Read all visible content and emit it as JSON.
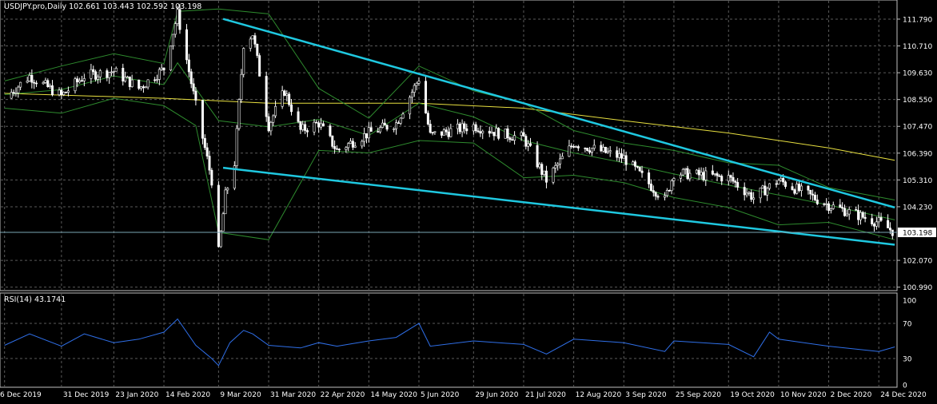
{
  "window": {
    "symbol_header": "USDJPY.pro,Daily  102.661 103.443 102.592 103.198",
    "rsi_header": "RSI(14) 43.1741"
  },
  "colors": {
    "background": "#000000",
    "grid": "#5a5a5a",
    "bull_candle": "#000000",
    "bear_candle": "#ffffff",
    "candle_wick": "#ffffff",
    "bollinger": "#2e8b2e",
    "moving_average": "#e8e040",
    "trendline": "#1fc8e0",
    "rsi_line": "#2f6fe8",
    "price_line": "#7aa6b4",
    "axis_text": "#ffffff"
  },
  "chart_data": [
    {
      "type": "candlestick",
      "title": "USDJPY.pro,Daily",
      "ohlc_last": {
        "open": 102.661,
        "high": 103.443,
        "low": 102.592,
        "close": 103.198
      },
      "current_price_label": "103.198",
      "y_ticks": [
        "111.790",
        "110.710",
        "109.630",
        "108.550",
        "107.470",
        "106.390",
        "105.310",
        "104.230",
        "103.198",
        "102.070",
        "100.990"
      ],
      "ylim": [
        100.85,
        112.4
      ],
      "x_ticks": [
        "6 Dec 2019",
        "31 Dec 2019",
        "23 Jan 2020",
        "14 Feb 2020",
        "9 Mar 2020",
        "31 Mar 2020",
        "22 Apr 2020",
        "14 May 2020",
        "5 Jun 2020",
        "29 Jun 2020",
        "21 Jul 2020",
        "12 Aug 2020",
        "3 Sep 2020",
        "25 Sep 2020",
        "19 Oct 2020",
        "10 Nov 2020",
        "2 Dec 2020",
        "24 Dec 2020"
      ],
      "close_path": [
        [
          "6 Dec 2019",
          108.6
        ],
        [
          "17 Dec 2019",
          109.5
        ],
        [
          "31 Dec 2019",
          108.7
        ],
        [
          "10 Jan 2020",
          109.5
        ],
        [
          "23 Jan 2020",
          109.7
        ],
        [
          "3 Feb 2020",
          109.0
        ],
        [
          "14 Feb 2020",
          109.8
        ],
        [
          "20 Feb 2020",
          112.0
        ],
        [
          "28 Feb 2020",
          108.3
        ],
        [
          "6 Mar 2020",
          105.3
        ],
        [
          "9 Mar 2020",
          102.4
        ],
        [
          "12 Mar 2020",
          104.7
        ],
        [
          "16 Mar 2020",
          106.0
        ],
        [
          "20 Mar 2020",
          110.8
        ],
        [
          "24 Mar 2020",
          111.2
        ],
        [
          "31 Mar 2020",
          107.5
        ],
        [
          "7 Apr 2020",
          108.9
        ],
        [
          "14 Apr 2020",
          107.3
        ],
        [
          "22 Apr 2020",
          107.6
        ],
        [
          "30 Apr 2020",
          106.5
        ],
        [
          "14 May 2020",
          107.2
        ],
        [
          "26 May 2020",
          107.6
        ],
        [
          "5 Jun 2020",
          109.4
        ],
        [
          "10 Jun 2020",
          107.1
        ],
        [
          "29 Jun 2020",
          107.5
        ],
        [
          "10 Jul 2020",
          107.2
        ],
        [
          "21 Jul 2020",
          107.0
        ],
        [
          "31 Jul 2020",
          105.3
        ],
        [
          "12 Aug 2020",
          106.8
        ],
        [
          "3 Sep 2020",
          106.2
        ],
        [
          "21 Sep 2020",
          104.5
        ],
        [
          "25 Sep 2020",
          105.6
        ],
        [
          "19 Oct 2020",
          105.4
        ],
        [
          "30 Oct 2020",
          104.6
        ],
        [
          "10 Nov 2020",
          105.3
        ],
        [
          "2 Dec 2020",
          104.3
        ],
        [
          "24 Dec 2020",
          103.6
        ],
        [
          "31 Dec 2020",
          103.198
        ]
      ],
      "bollinger_upper": [
        [
          "6 Dec 2019",
          109.3
        ],
        [
          "31 Dec 2019",
          109.9
        ],
        [
          "23 Jan 2020",
          110.4
        ],
        [
          "14 Feb 2020",
          110.0
        ],
        [
          "20 Feb 2020",
          112.1
        ],
        [
          "9 Mar 2020",
          112.2
        ],
        [
          "31 Mar 2020",
          112.0
        ],
        [
          "22 Apr 2020",
          109.0
        ],
        [
          "14 May 2020",
          107.8
        ],
        [
          "5 Jun 2020",
          109.9
        ],
        [
          "29 Jun 2020",
          108.9
        ],
        [
          "21 Jul 2020",
          108.4
        ],
        [
          "12 Aug 2020",
          107.3
        ],
        [
          "3 Sep 2020",
          106.8
        ],
        [
          "25 Sep 2020",
          106.5
        ],
        [
          "19 Oct 2020",
          106.0
        ],
        [
          "10 Nov 2020",
          105.9
        ],
        [
          "2 Dec 2020",
          105.0
        ],
        [
          "31 Dec 2020",
          104.5
        ]
      ],
      "bollinger_lower": [
        [
          "6 Dec 2019",
          108.2
        ],
        [
          "31 Dec 2019",
          108.0
        ],
        [
          "23 Jan 2020",
          108.6
        ],
        [
          "14 Feb 2020",
          108.3
        ],
        [
          "28 Feb 2020",
          107.5
        ],
        [
          "9 Mar 2020",
          103.2
        ],
        [
          "31 Mar 2020",
          102.9
        ],
        [
          "22 Apr 2020",
          106.5
        ],
        [
          "14 May 2020",
          106.4
        ],
        [
          "5 Jun 2020",
          106.9
        ],
        [
          "29 Jun 2020",
          106.8
        ],
        [
          "21 Jul 2020",
          105.4
        ],
        [
          "12 Aug 2020",
          105.5
        ],
        [
          "3 Sep 2020",
          105.2
        ],
        [
          "25 Sep 2020",
          104.6
        ],
        [
          "19 Oct 2020",
          104.2
        ],
        [
          "10 Nov 2020",
          103.5
        ],
        [
          "2 Dec 2020",
          103.6
        ],
        [
          "31 Dec 2020",
          102.9
        ]
      ],
      "moving_average": [
        [
          "6 Dec 2019",
          108.8
        ],
        [
          "14 Feb 2020",
          108.6
        ],
        [
          "31 Mar 2020",
          108.4
        ],
        [
          "5 Jun 2020",
          108.4
        ],
        [
          "21 Jul 2020",
          108.2
        ],
        [
          "3 Sep 2020",
          107.7
        ],
        [
          "19 Oct 2020",
          107.2
        ],
        [
          "2 Dec 2020",
          106.6
        ],
        [
          "31 Dec 2020",
          106.1
        ]
      ],
      "trendlines": [
        {
          "from": [
            "11 Mar 2020",
            111.8
          ],
          "to": [
            "31 Dec 2020",
            104.2
          ]
        },
        {
          "from": [
            "11 Mar 2020",
            105.8
          ],
          "to": [
            "31 Dec 2020",
            102.7
          ]
        }
      ]
    },
    {
      "type": "line",
      "title": "RSI(14)",
      "value_last": 43.1741,
      "y_ticks": [
        "100",
        "70",
        "30",
        "0"
      ],
      "ylim": [
        0,
        100
      ],
      "series": [
        {
          "values": [
            [
              "6 Dec 2019",
              45
            ],
            [
              "17 Dec 2019",
              58
            ],
            [
              "31 Dec 2019",
              44
            ],
            [
              "10 Jan 2020",
              58
            ],
            [
              "23 Jan 2020",
              48
            ],
            [
              "3 Feb 2020",
              52
            ],
            [
              "14 Feb 2020",
              60
            ],
            [
              "20 Feb 2020",
              75
            ],
            [
              "28 Feb 2020",
              45
            ],
            [
              "6 Mar 2020",
              30
            ],
            [
              "9 Mar 2020",
              22
            ],
            [
              "14 Mar 2020",
              48
            ],
            [
              "20 Mar 2020",
              62
            ],
            [
              "24 Mar 2020",
              58
            ],
            [
              "31 Mar 2020",
              45
            ],
            [
              "14 Apr 2020",
              42
            ],
            [
              "22 Apr 2020",
              48
            ],
            [
              "30 Apr 2020",
              44
            ],
            [
              "14 May 2020",
              50
            ],
            [
              "26 May 2020",
              54
            ],
            [
              "5 Jun 2020",
              70
            ],
            [
              "10 Jun 2020",
              44
            ],
            [
              "29 Jun 2020",
              50
            ],
            [
              "21 Jul 2020",
              46
            ],
            [
              "31 Jul 2020",
              35
            ],
            [
              "12 Aug 2020",
              52
            ],
            [
              "3 Sep 2020",
              48
            ],
            [
              "21 Sep 2020",
              38
            ],
            [
              "25 Sep 2020",
              50
            ],
            [
              "19 Oct 2020",
              46
            ],
            [
              "30 Oct 2020",
              32
            ],
            [
              "6 Nov 2020",
              60
            ],
            [
              "10 Nov 2020",
              52
            ],
            [
              "2 Dec 2020",
              44
            ],
            [
              "24 Dec 2020",
              38
            ],
            [
              "31 Dec 2020",
              43.1741
            ]
          ]
        }
      ]
    }
  ]
}
